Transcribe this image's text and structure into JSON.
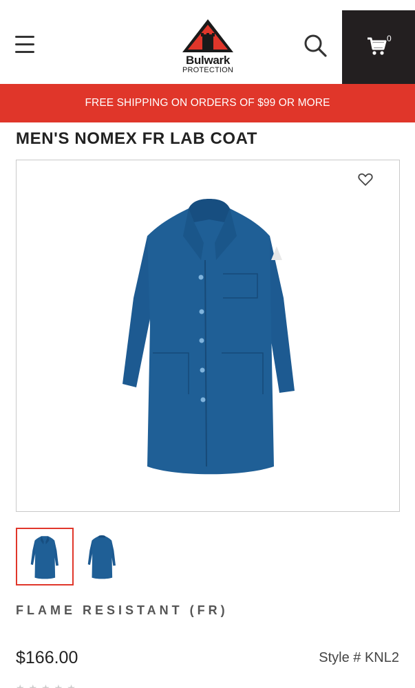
{
  "header": {
    "logo_name": "Bulwark",
    "logo_sub": "PROTECTION",
    "cart_count": "0",
    "menu_icon": "hamburger-icon",
    "search_icon": "search-icon",
    "cart_icon": "cart-icon"
  },
  "promo": {
    "text": "FREE SHIPPING ON ORDERS OF $99 OR MORE"
  },
  "product": {
    "title": "MEN'S NOMEX FR LAB COAT",
    "category": "FLAME RESISTANT (FR)",
    "price": "$166.00",
    "style": "Style # KNL2",
    "color": "#1f5f96"
  },
  "colors": {
    "brand_red": "#e0362a",
    "cart_bg": "#231f20"
  }
}
